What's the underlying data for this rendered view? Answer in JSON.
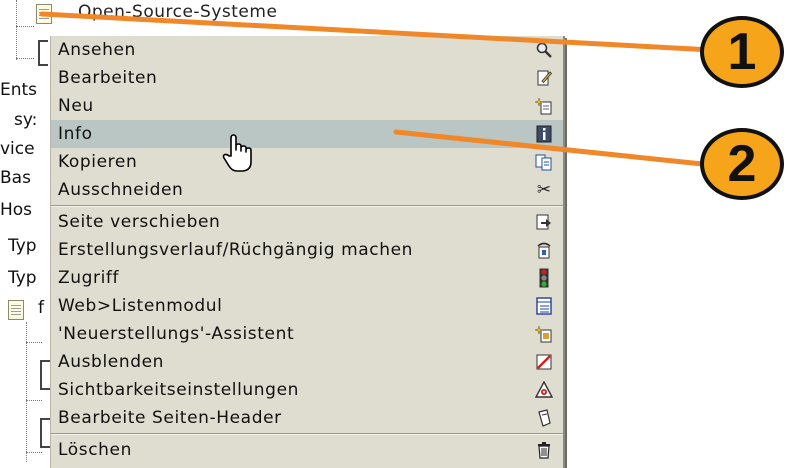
{
  "tree": {
    "top_label": "Open-Source-Systeme",
    "side_labels": [
      "Ents",
      "sy:",
      "vice",
      "Bas",
      "Hos",
      "Typ",
      "Typ",
      "f"
    ]
  },
  "menu": {
    "items": [
      {
        "label": "Ansehen",
        "icon": "magnifier-icon"
      },
      {
        "label": "Bearbeiten",
        "icon": "edit-page-icon"
      },
      {
        "label": "Neu",
        "icon": "new-page-sparkle-icon"
      },
      {
        "label": "Info",
        "icon": "info-icon",
        "selected": true
      },
      {
        "label": "Kopieren",
        "icon": "copy-icon"
      },
      {
        "label": "Ausschneiden",
        "icon": "scissors-icon"
      },
      {
        "label": "Seite verschieben",
        "icon": "move-page-icon"
      },
      {
        "label": "Erstellungsverlauf/Rüchgängig machen",
        "icon": "history-icon"
      },
      {
        "label": "Zugriff",
        "icon": "traffic-light-icon"
      },
      {
        "label": "Web>Listenmodul",
        "icon": "list-module-icon"
      },
      {
        "label": "'Neuerstellungs'-Assistent",
        "icon": "wizard-icon"
      },
      {
        "label": "Ausblenden",
        "icon": "hide-icon"
      },
      {
        "label": "Sichtbarkeitseinstellungen",
        "icon": "visibility-settings-icon"
      },
      {
        "label": "Bearbeite Seiten-Header",
        "icon": "edit-header-icon"
      },
      {
        "label": "Löschen",
        "icon": "trash-icon"
      }
    ]
  },
  "callouts": {
    "one": "1",
    "two": "2",
    "color": "#f6a51a",
    "line_color": "#f0882a"
  }
}
